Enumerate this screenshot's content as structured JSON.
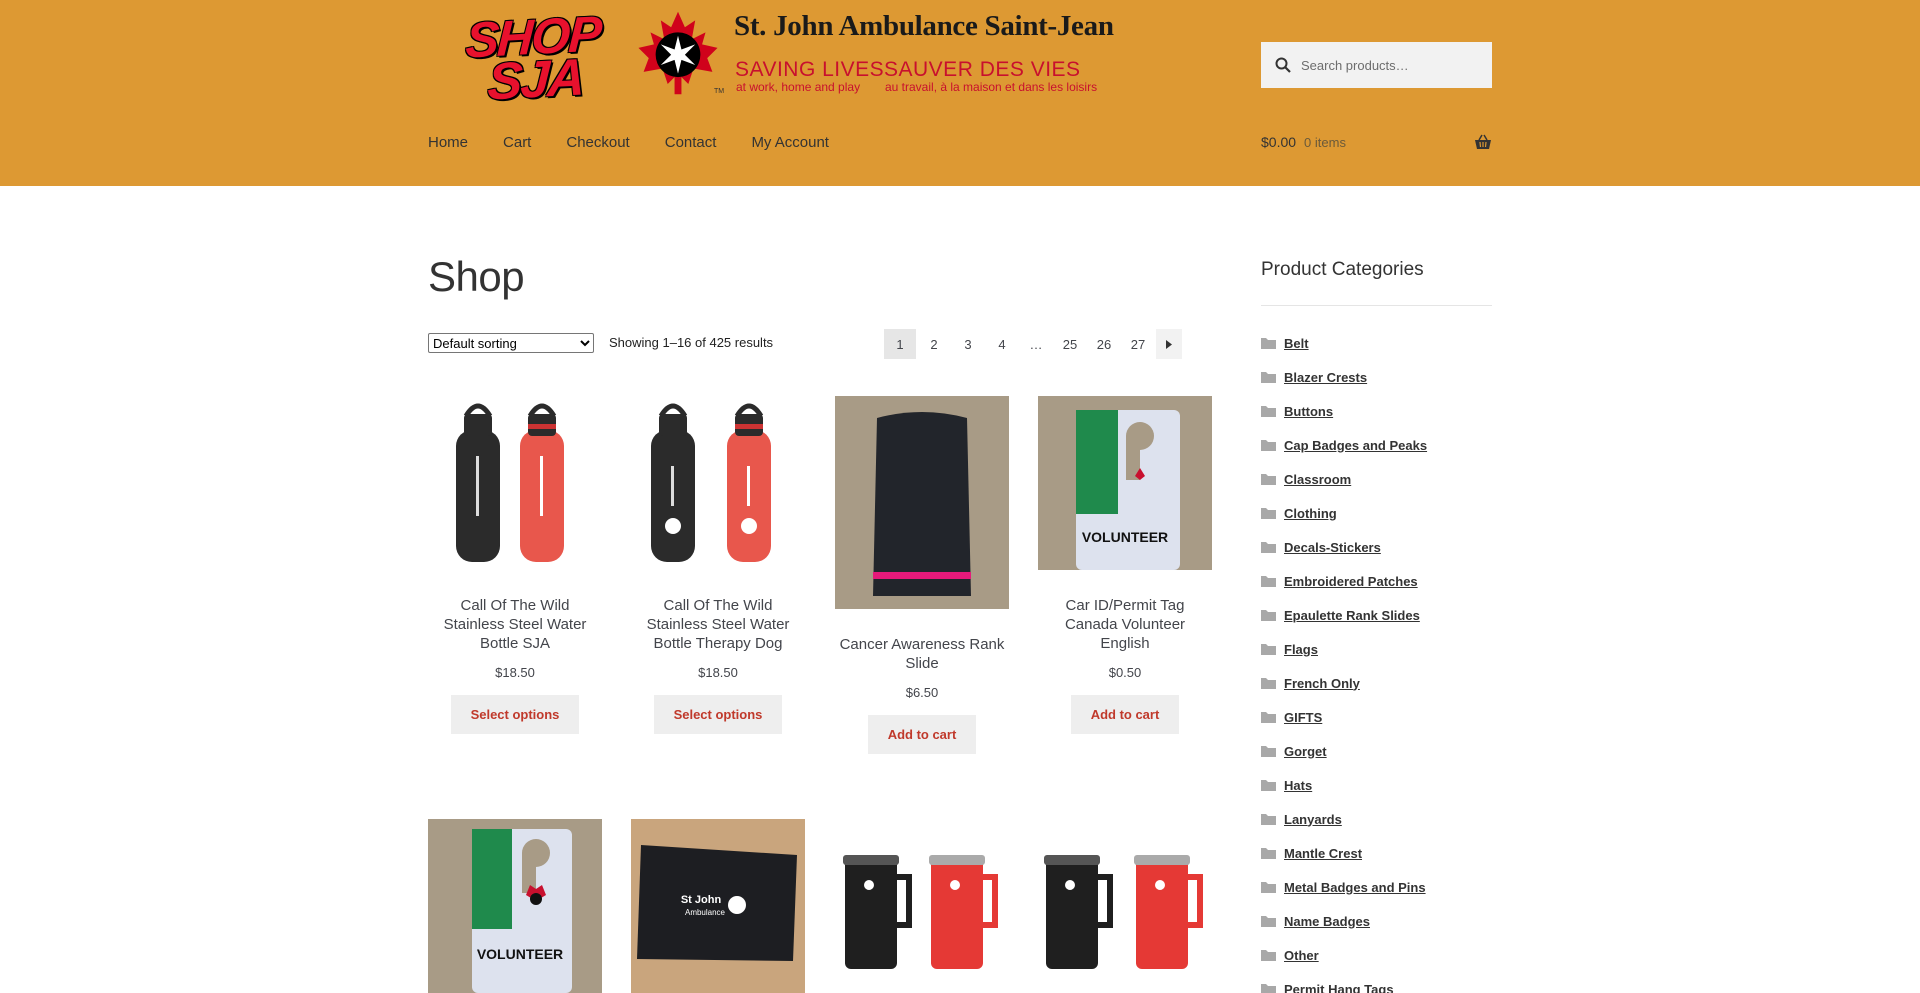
{
  "header": {
    "logo": {
      "shop_line1": "SHOP",
      "shop_line2": "SJA",
      "org_name": "St. John Ambulance Saint-Jean",
      "slogan_en": "SAVING LIVES",
      "slogan_fr": "SAUVER DES VIES",
      "sub_en": "at work, home and play",
      "sub_fr": "au travail, à la maison et dans les loisirs",
      "tm": "TM"
    },
    "search": {
      "placeholder": "Search products…",
      "icon": "search-icon"
    },
    "nav": [
      "Home",
      "Cart",
      "Checkout",
      "Contact",
      "My Account"
    ],
    "cart": {
      "amount": "$0.00",
      "count": "0 items",
      "icon": "basket-icon"
    },
    "colors": {
      "header_bg": "#dd9933",
      "accent": "#c0392b"
    }
  },
  "shop": {
    "title": "Shop",
    "sorting": {
      "selected": "Default sorting"
    },
    "result_count": "Showing 1–16 of 425 results",
    "pagination": [
      "1",
      "2",
      "3",
      "4",
      "…",
      "25",
      "26",
      "27"
    ],
    "current_page": "1",
    "products": [
      {
        "title": "Call Of The Wild Stainless Steel Water Bottle SJA",
        "price": "$18.50",
        "button": "Select options"
      },
      {
        "title": "Call Of The Wild Stainless Steel Water Bottle Therapy Dog",
        "price": "$18.50",
        "button": "Select options"
      },
      {
        "title": "Cancer Awareness Rank Slide",
        "price": "$6.50",
        "button": "Add to cart"
      },
      {
        "title": "Car ID/Permit Tag Canada Volunteer English",
        "price": "$0.50",
        "button": "Add to cart"
      }
    ],
    "product_images_text": {
      "volunteer": "VOLUNTEER",
      "st_john": "St John",
      "ambulance": "Ambulance"
    }
  },
  "sidebar": {
    "title": "Product Categories",
    "categories": [
      "Belt",
      "Blazer Crests",
      "Buttons",
      "Cap Badges and Peaks",
      "Classroom",
      "Clothing",
      "Decals-Stickers",
      "Embroidered Patches",
      "Epaulette Rank Slides",
      "Flags",
      "French Only",
      "GIFTS",
      "Gorget",
      "Hats",
      "Lanyards",
      "Mantle Crest",
      "Metal Badges and Pins",
      "Name Badges",
      "Other",
      "Permit Hang Tags"
    ]
  }
}
